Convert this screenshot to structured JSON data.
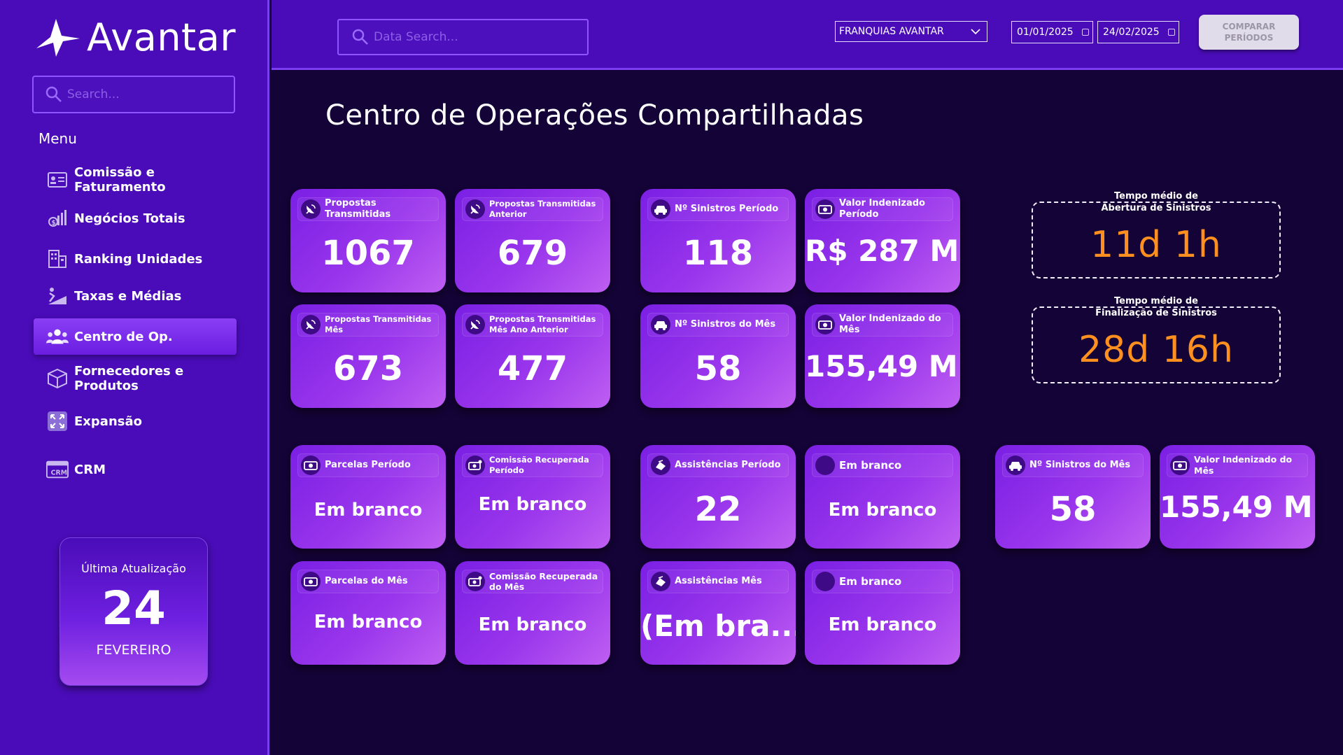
{
  "app": {
    "logo_text": "Avantar"
  },
  "sidebar": {
    "search_placeholder": "Search...",
    "menu_label": "Menu",
    "items": [
      {
        "label": "Comissão e Faturamento",
        "icon": "id-card-icon"
      },
      {
        "label": "Negócios Totais",
        "icon": "money-chart-icon"
      },
      {
        "label": "Ranking Unidades",
        "icon": "building-icon"
      },
      {
        "label": "Taxas e Médias",
        "icon": "ramp-chart-icon"
      },
      {
        "label": "Centro de Op.",
        "icon": "users-icon",
        "active": true
      },
      {
        "label": "Fornecedores e Produtos",
        "icon": "box-icon"
      },
      {
        "label": "Expansão",
        "icon": "expand-icon"
      },
      {
        "label": "CRM",
        "icon": "crm-icon"
      }
    ],
    "update": {
      "title": "Última Atualização",
      "day": "24",
      "month": "FEVEREIRO"
    }
  },
  "topbar": {
    "search_placeholder": "Data Search...",
    "dropdown_value": "FRANQUIAS AVANTAR",
    "date_start": "01/01/2025",
    "date_end": "24/02/2025",
    "compare_label_1": "COMPARAR",
    "compare_label_2": "PERÍODOS"
  },
  "main": {
    "title": "Centro de Operações Compartilhadas",
    "kpis": {
      "propostas_periodo": {
        "label": "Propostas Transmitidas",
        "value": "1067"
      },
      "propostas_anterior": {
        "label": "Propostas Transmitidas Anterior",
        "value": "679"
      },
      "sinistros_periodo": {
        "label": "Nº Sinistros Período",
        "value": "118"
      },
      "indenizado_periodo": {
        "label": "Valor Indenizado Período",
        "value": "R$ 287 Mil"
      },
      "propostas_mes": {
        "label": "Propostas Transmitidas Mês",
        "value": "673"
      },
      "propostas_mes_ano_ant": {
        "label": "Propostas Transmitidas Mês Ano Anterior",
        "value": "477"
      },
      "sinistros_mes": {
        "label": "Nº Sinistros do Mês",
        "value": "58"
      },
      "indenizado_mes": {
        "label": "Valor Indenizado do Mês",
        "value": "155,49 Mil"
      },
      "parcelas_periodo": {
        "label": "Parcelas Período",
        "value": "Em branco"
      },
      "comissao_periodo": {
        "label": "Comissão Recuperada Período",
        "value": "Em branco"
      },
      "assistencias_periodo": {
        "label": "Assistências Período",
        "value": "22"
      },
      "em_branco_1": {
        "label": "Em branco",
        "value": "Em branco"
      },
      "parcelas_mes": {
        "label": "Parcelas do Mês",
        "value": "Em branco"
      },
      "comissao_mes": {
        "label": "Comissão Recuperada do Mês",
        "value": "Em branco"
      },
      "assistencias_mes": {
        "label": "Assistências Mês",
        "value": "(Em bra..."
      },
      "em_branco_2": {
        "label": "Em branco",
        "value": "Em branco"
      },
      "sinistros_mes_2": {
        "label": "Nº Sinistros do Mês",
        "value": "58"
      },
      "indenizado_mes_2": {
        "label": "Valor Indenizado do Mês",
        "value": "155,49 Mil"
      }
    },
    "tempo_abertura": {
      "label_1": "Tempo médio de",
      "label_2": "Abertura de Sinistros",
      "value": "11d 1h"
    },
    "tempo_finalizacao": {
      "label_1": "Tempo médio de",
      "label_2": "Finalização de Sinistros",
      "value": "28d 16h"
    }
  },
  "colors": {
    "sidebar_bg": "#4a0cb8",
    "page_bg": "#140336",
    "card_accent": "#9a36ec",
    "time_value": "#ff8f1f"
  }
}
